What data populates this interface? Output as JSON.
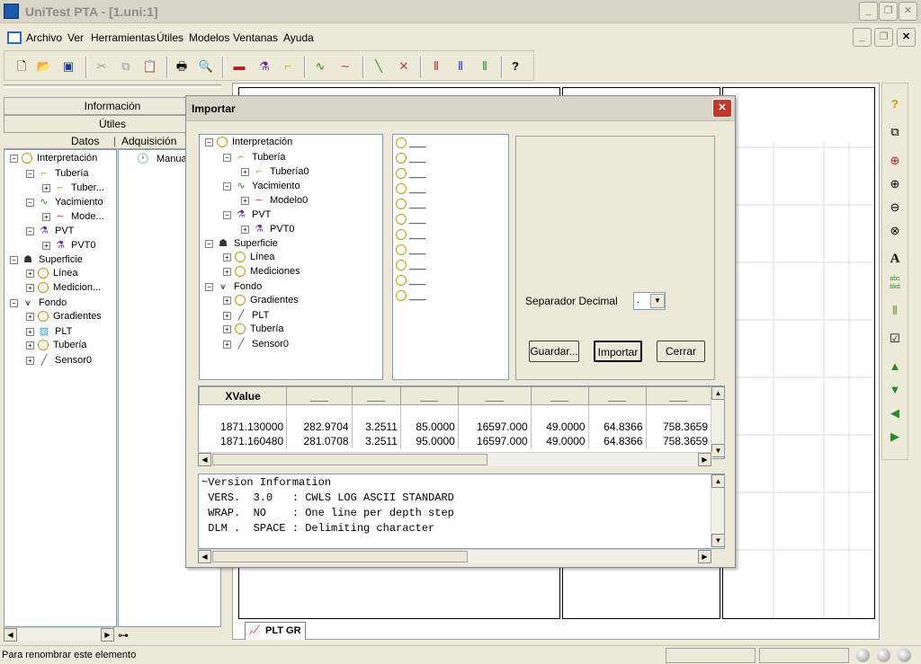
{
  "app": {
    "title": "UniTest PTA - [1.uni:1]"
  },
  "menu": [
    "Archivo",
    "Ver",
    "Herramientas",
    "Útiles",
    "Modelos",
    "Ventanas",
    "Ayuda"
  ],
  "left_panel": {
    "sections": [
      "Información",
      "Útiles"
    ],
    "tabs": [
      "Datos",
      "Adquisición"
    ],
    "adq_item": "Manual",
    "tree": [
      {
        "level": 0,
        "pm": "−",
        "icon": "circle-icon",
        "label": "Interpretación"
      },
      {
        "level": 1,
        "pm": "−",
        "icon": "pipe-icon",
        "label": "Tubería"
      },
      {
        "level": 2,
        "pm": "+",
        "icon": "pipe-icon",
        "label": "Tuber..."
      },
      {
        "level": 1,
        "pm": "−",
        "icon": "reservoir-icon",
        "label": "Yacimiento"
      },
      {
        "level": 2,
        "pm": "+",
        "icon": "curve-icon",
        "label": "Mode..."
      },
      {
        "level": 1,
        "pm": "−",
        "icon": "flask-icon",
        "label": "PVT"
      },
      {
        "level": 2,
        "pm": "+",
        "icon": "flask-icon",
        "label": "PVT0"
      },
      {
        "level": 0,
        "pm": "−",
        "icon": "surface-icon",
        "label": "Superficie"
      },
      {
        "level": 1,
        "pm": "+",
        "icon": "circle-icon",
        "label": "Línea"
      },
      {
        "level": 1,
        "pm": "+",
        "icon": "circle-icon",
        "label": "Medicion..."
      },
      {
        "level": 0,
        "pm": "−",
        "icon": "well-icon",
        "label": "Fondo"
      },
      {
        "level": 1,
        "pm": "+",
        "icon": "circle-icon",
        "label": "Gradientes"
      },
      {
        "level": 1,
        "pm": "+",
        "icon": "plt-icon",
        "label": "PLT"
      },
      {
        "level": 1,
        "pm": "+",
        "icon": "circle-icon",
        "label": "Tubería"
      },
      {
        "level": 1,
        "pm": "+",
        "icon": "sensor-icon",
        "label": "Sensor0"
      }
    ]
  },
  "dialog": {
    "title": "Importar",
    "tree": [
      {
        "level": 0,
        "pm": "−",
        "icon": "circle-icon",
        "label": "Interpretación"
      },
      {
        "level": 1,
        "pm": "−",
        "icon": "pipe-icon",
        "label": "Tubería"
      },
      {
        "level": 2,
        "pm": "+",
        "icon": "pipe-icon",
        "label": "Tubería0"
      },
      {
        "level": 1,
        "pm": "−",
        "icon": "reservoir-icon",
        "label": "Yacimiento"
      },
      {
        "level": 2,
        "pm": "+",
        "icon": "curve-icon",
        "label": "Modelo0"
      },
      {
        "level": 1,
        "pm": "−",
        "icon": "flask-icon",
        "label": "PVT"
      },
      {
        "level": 2,
        "pm": "+",
        "icon": "flask-icon",
        "label": "PVT0"
      },
      {
        "level": 0,
        "pm": "−",
        "icon": "surface-icon",
        "label": "Superficie"
      },
      {
        "level": 1,
        "pm": "+",
        "icon": "circle-icon",
        "label": "Línea"
      },
      {
        "level": 1,
        "pm": "+",
        "icon": "circle-icon",
        "label": "Mediciones"
      },
      {
        "level": 0,
        "pm": "−",
        "icon": "well-icon",
        "label": "Fondo"
      },
      {
        "level": 1,
        "pm": "+",
        "icon": "circle-icon",
        "label": "Gradientes"
      },
      {
        "level": 1,
        "pm": "+",
        "icon": "sensor-icon",
        "label": "PLT"
      },
      {
        "level": 1,
        "pm": "+",
        "icon": "circle-icon",
        "label": "Tubería"
      },
      {
        "level": 1,
        "pm": "+",
        "icon": "sensor-icon",
        "label": "Sensor0"
      }
    ],
    "radio_label": "___",
    "radio_count": 11,
    "separator_label": "Separador Decimal",
    "separator_value": ".",
    "buttons": {
      "save": "Guardar...",
      "import": "Importar",
      "close": "Cerrar"
    },
    "grid": {
      "headers": [
        "XValue",
        "___",
        "___",
        "___",
        "___",
        "___",
        "___",
        "___"
      ],
      "rows": [
        [
          "",
          "",
          "",
          "",
          "",
          "",
          "",
          ""
        ],
        [
          "1871.130000",
          "282.9704",
          "3.2511",
          "85.0000",
          "16597.000",
          "49.0000",
          "64.8366",
          "758.3659"
        ],
        [
          "1871.160480",
          "281.0708",
          "3.2511",
          "95.0000",
          "16597.000",
          "49.0000",
          "64.8366",
          "758.3659"
        ]
      ]
    },
    "log_text": [
      "~Version Information",
      " VERS.  3.0   : CWLS LOG ASCII STANDARD",
      " WRAP.  NO    : One line per depth step",
      " DLM .  SPACE : Delimiting character"
    ]
  },
  "plot_tab": "PLT GR",
  "status": "Para renombrar este elemento",
  "colors": {
    "accent": "#316AC5",
    "close_red": "#C0392B"
  }
}
